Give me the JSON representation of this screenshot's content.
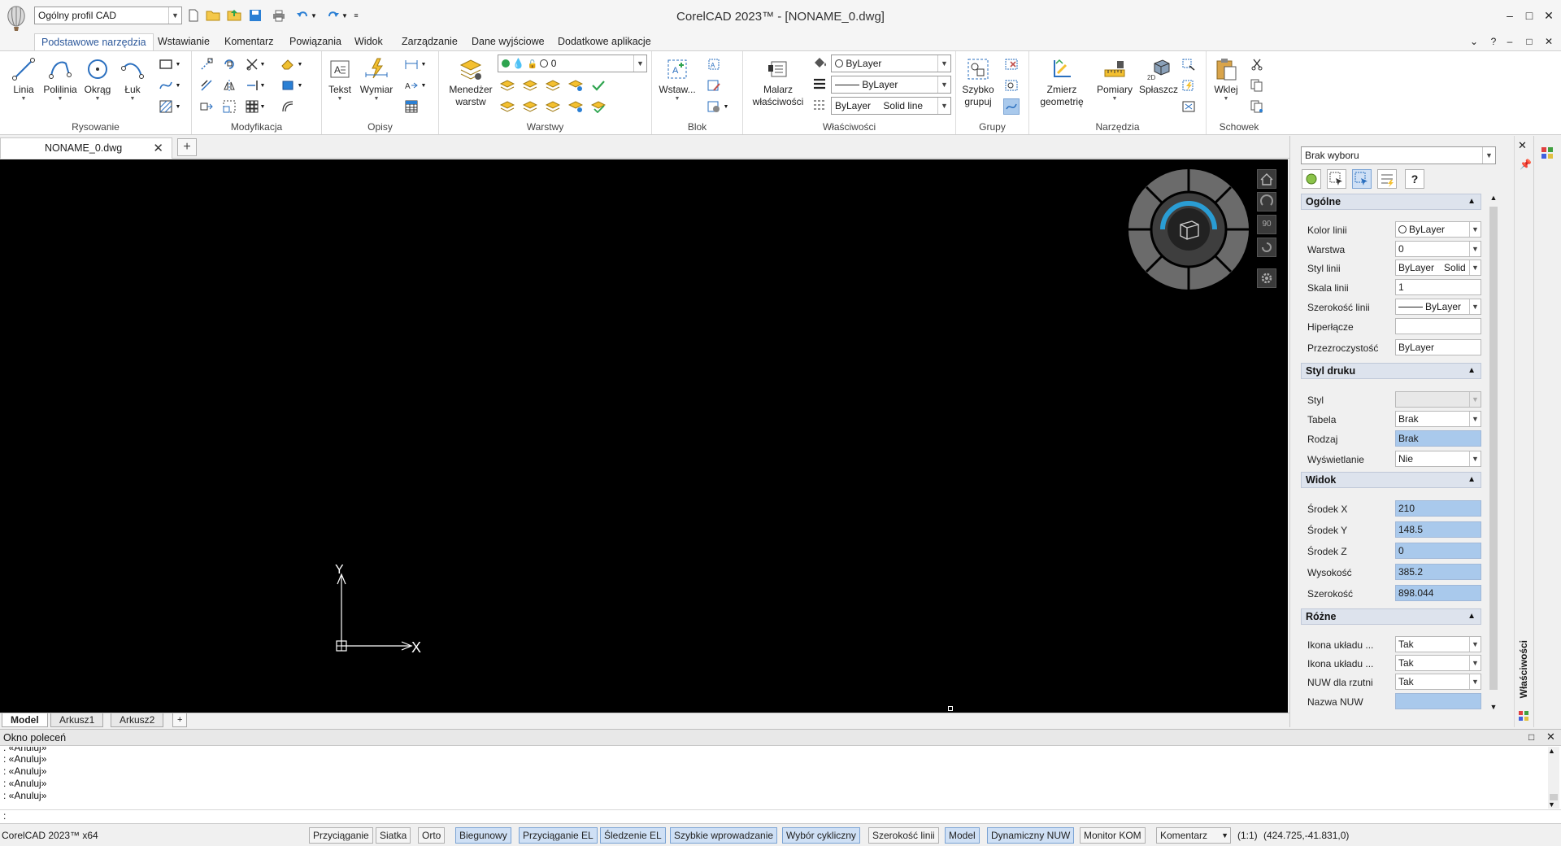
{
  "app": {
    "window_title": "CorelCAD 2023™ - [NONAME_0.dwg]",
    "profile": "Ogólny profil CAD"
  },
  "window_controls": {
    "minimize": "–",
    "maximize": "□",
    "close": "✕"
  },
  "ribbon_tabs": [
    "Podstawowe narzędzia",
    "Wstawianie",
    "Komentarz",
    "Powiązania",
    "Widok",
    "Zarządzanie",
    "Dane wyjściowe",
    "Dodatkowe aplikacje"
  ],
  "ribbon_right": {
    "help": "?",
    "collapse": "⌄"
  },
  "groups": {
    "rysowanie": {
      "label": "Rysowanie",
      "buttons": [
        "Linia",
        "Polilinia",
        "Okrąg",
        "Łuk"
      ]
    },
    "modyfikacja": {
      "label": "Modyfikacja"
    },
    "opisy": {
      "label": "Opisy",
      "buttons": [
        "Tekst",
        "Wymiar"
      ]
    },
    "warstwy": {
      "label": "Warstwy",
      "manager_line1": "Menedżer",
      "manager_line2": "warstw",
      "layer_value": "0"
    },
    "blok": {
      "label": "Blok",
      "insert": "Wstaw..."
    },
    "wlasciwosci": {
      "label": "Właściwości",
      "painter_line1": "Malarz",
      "painter_line2": "właściwości",
      "color": "ByLayer",
      "linetype": "ByLayer",
      "style_left": "ByLayer",
      "style_right": "Solid line"
    },
    "grupy": {
      "label": "Grupy",
      "btn_line1": "Szybko",
      "btn_line2": "grupuj"
    },
    "narzedzia": {
      "label": "Narzędzia",
      "measure_line1": "Zmierz",
      "measure_line2": "geometrię",
      "pomiary": "Pomiary",
      "splaszcz": "Spłaszcz"
    },
    "schowek": {
      "label": "Schowek",
      "paste": "Wklej"
    }
  },
  "doc_tab": {
    "name": "NONAME_0.dwg",
    "close": "✕",
    "new": "+"
  },
  "canvas": {
    "ucs_x": "X",
    "ucs_y": "Y",
    "viewcube_labels": {
      "ninety": "90"
    }
  },
  "layout_tabs": [
    "Model",
    "Arkusz1",
    "Arkusz2"
  ],
  "properties": {
    "selection": "Brak wyboru",
    "sections": {
      "ogolne": {
        "title": "Ogólne",
        "rows": [
          {
            "label": "Kolor linii",
            "value": "ByLayer"
          },
          {
            "label": "Warstwa",
            "value": "0"
          },
          {
            "label": "Styl linii",
            "value": "ByLayer",
            "value2": "Solid"
          },
          {
            "label": "Skala linii",
            "value": "1"
          },
          {
            "label": "Szerokość linii",
            "value": "ByLayer"
          },
          {
            "label": "Hiperłącze",
            "value": ""
          },
          {
            "label": "Przezroczystość",
            "value": "ByLayer"
          }
        ]
      },
      "styl_druku": {
        "title": "Styl druku",
        "rows": [
          {
            "label": "Styl",
            "value": ""
          },
          {
            "label": "Tabela",
            "value": "Brak"
          },
          {
            "label": "Rodzaj",
            "value": "Brak"
          },
          {
            "label": "Wyświetlanie",
            "value": "Nie"
          }
        ]
      },
      "widok": {
        "title": "Widok",
        "rows": [
          {
            "label": "Środek X",
            "value": "210"
          },
          {
            "label": "Środek Y",
            "value": "148.5"
          },
          {
            "label": "Środek Z",
            "value": "0"
          },
          {
            "label": "Wysokość",
            "value": "385.2"
          },
          {
            "label": "Szerokość",
            "value": "898.044"
          }
        ]
      },
      "rozne": {
        "title": "Różne",
        "rows": [
          {
            "label": "Ikona układu ...",
            "value": "Tak"
          },
          {
            "label": "Ikona układu ...",
            "value": "Tak"
          },
          {
            "label": "NUW dla rzutni",
            "value": "Tak"
          },
          {
            "label": "Nazwa NUW",
            "value": ""
          }
        ]
      }
    },
    "panel_title": "Właściwości"
  },
  "command_window": {
    "title": "Okno poleceń",
    "lines": [
      ": «Anuluj»",
      ": «Anuluj»",
      ": «Anuluj»",
      ": «Anuluj»",
      ": «Anuluj»"
    ],
    "prompt": ":"
  },
  "status_bar": {
    "app_name": "CorelCAD 2023™ x64",
    "buttons": [
      {
        "label": "Przyciąganie",
        "on": false
      },
      {
        "label": "Siatka",
        "on": false
      },
      {
        "label": "Orto",
        "on": false
      },
      {
        "label": "Biegunowy",
        "on": true
      },
      {
        "label": "Przyciąganie EL",
        "on": true
      },
      {
        "label": "Śledzenie EL",
        "on": true
      },
      {
        "label": "Szybkie wprowadzanie",
        "on": true
      },
      {
        "label": "Wybór cykliczny",
        "on": true
      },
      {
        "label": "Szerokość linii",
        "on": false
      },
      {
        "label": "Model",
        "on": true
      },
      {
        "label": "Dynamiczny NUW",
        "on": true
      },
      {
        "label": "Monitor KOM",
        "on": false
      }
    ],
    "annotation": "Komentarz",
    "scale": "(1:1)",
    "coordinates": "(424.725,-41.831,0)"
  },
  "colors": {
    "canvas": "#000000",
    "accent": "#2b579a",
    "highlight": "#a9c9ec"
  }
}
